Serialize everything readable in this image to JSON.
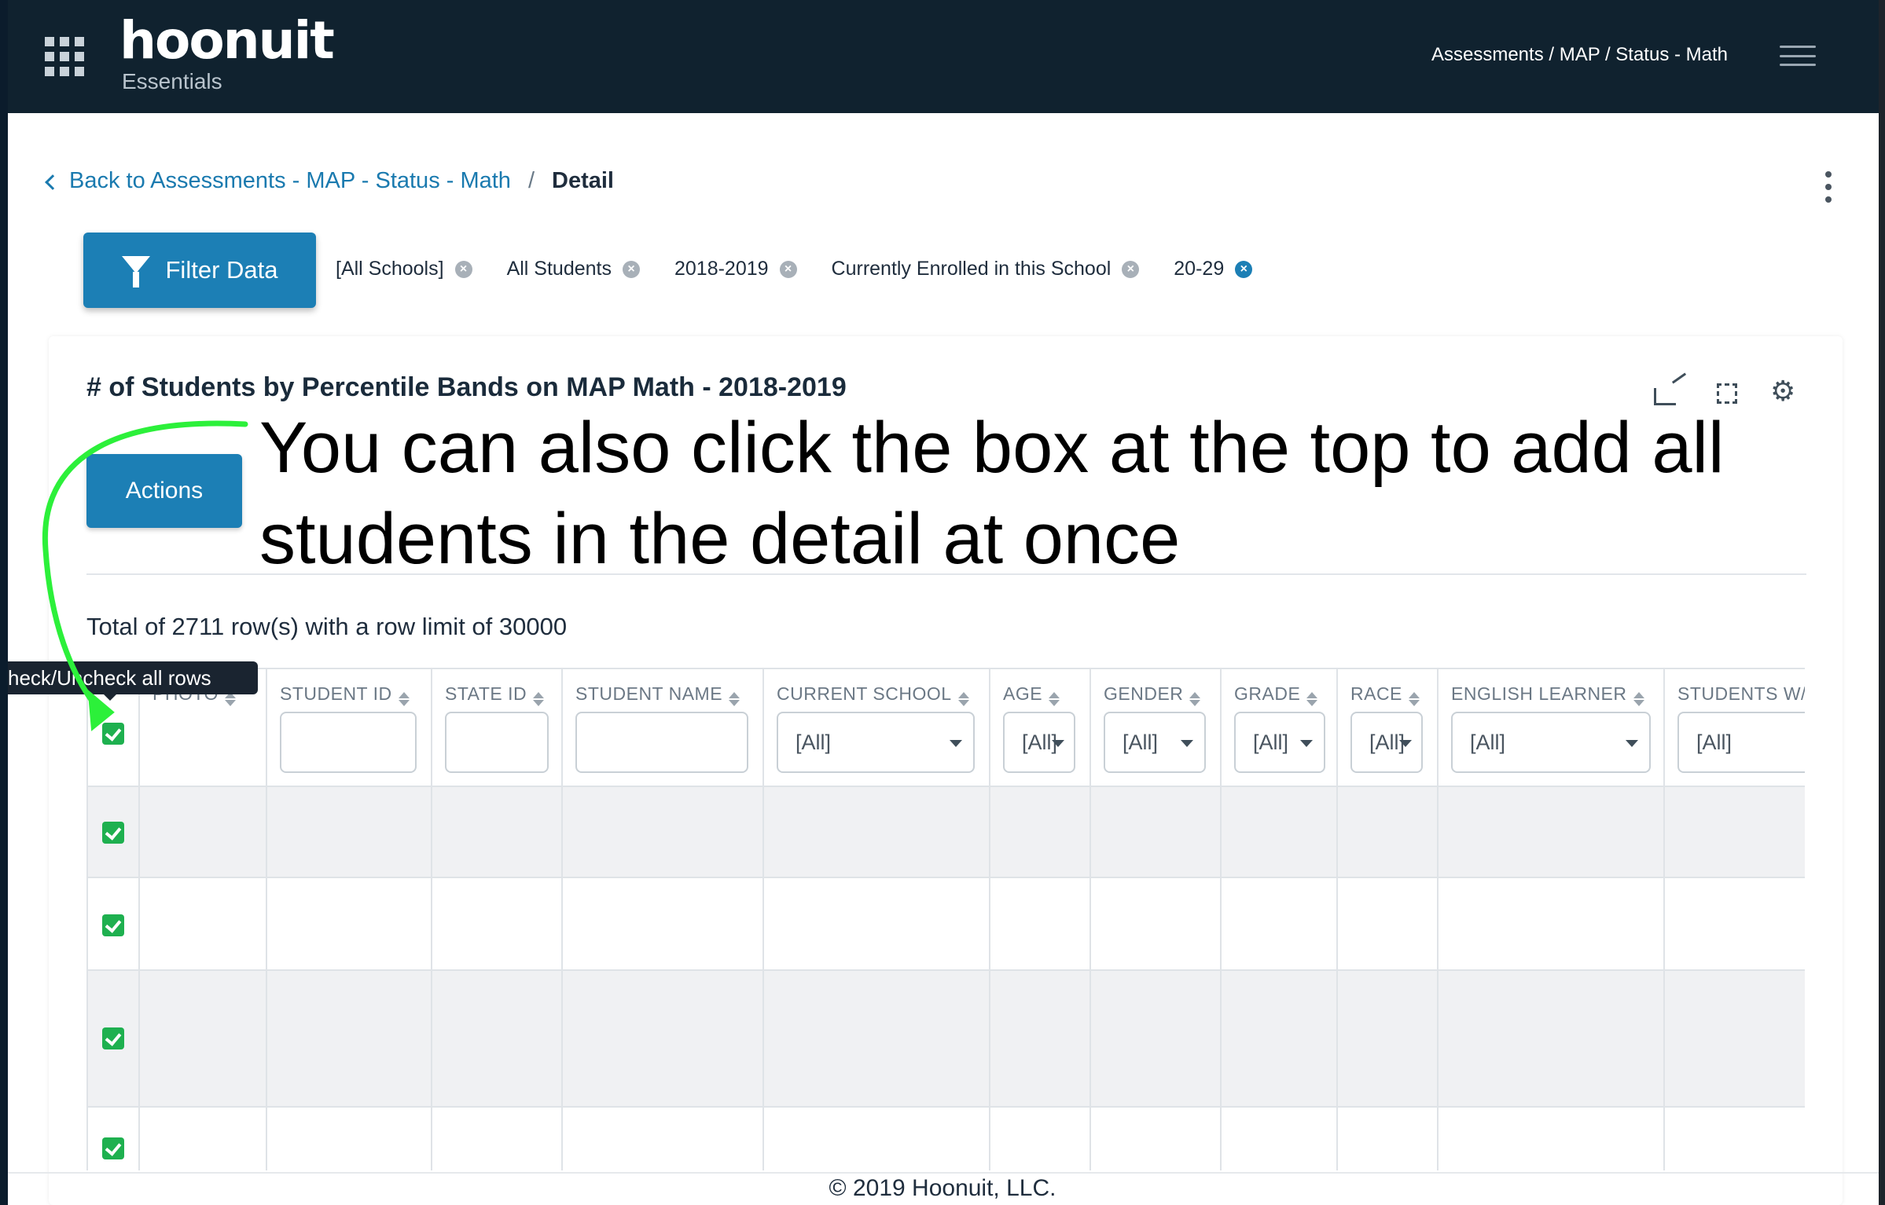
{
  "header": {
    "logo": "hoonuit",
    "logo_sub": "Essentials",
    "breadcrumb": "Assessments / MAP / Status - Math"
  },
  "breadcrumb": {
    "back": "Back to Assessments - MAP - Status - Math",
    "separator": "/",
    "current": "Detail"
  },
  "filters": {
    "button_label": "Filter Data",
    "chips": [
      {
        "label": "[All Schools]",
        "active": false
      },
      {
        "label": "All Students",
        "active": false
      },
      {
        "label": "2018-2019",
        "active": false
      },
      {
        "label": "Currently Enrolled in this School",
        "active": false
      },
      {
        "label": "20-29",
        "active": true
      }
    ]
  },
  "card": {
    "title": "# of Students by Percentile Bands on MAP Math - 2018-2019",
    "actions_label": "Actions",
    "annotation": "You can also click the box at the top to add all students in the detail at once",
    "row_count": "Total of 2711 row(s) with a row limit of 30000"
  },
  "table": {
    "tooltip": "heck/Uncheck all rows",
    "photo_header": "PHOTO",
    "columns": [
      {
        "label": "STUDENT ID",
        "filter": "",
        "type": "input"
      },
      {
        "label": "STATE ID",
        "filter": "",
        "type": "input"
      },
      {
        "label": "STUDENT NAME",
        "filter": "",
        "type": "input"
      },
      {
        "label": "CURRENT SCHOOL",
        "filter": "[All]",
        "type": "select"
      },
      {
        "label": "AGE",
        "filter": "[All]",
        "type": "select"
      },
      {
        "label": "GENDER",
        "filter": "[All]",
        "type": "select"
      },
      {
        "label": "GRADE",
        "filter": "[All]",
        "type": "select"
      },
      {
        "label": "RACE",
        "filter": "[All]",
        "type": "select"
      },
      {
        "label": "ENGLISH LEARNER",
        "filter": "[All]",
        "type": "select"
      },
      {
        "label": "STUDENTS W/",
        "filter": "[All]",
        "type": "select"
      }
    ],
    "rows_checked": [
      true,
      true,
      true,
      true
    ]
  },
  "footer": "© 2019 Hoonuit, LLC.",
  "colors": {
    "nav_bg": "#10222f",
    "accent": "#1c7fb5",
    "check": "#1eb04f",
    "arrow": "#2cf03a"
  }
}
